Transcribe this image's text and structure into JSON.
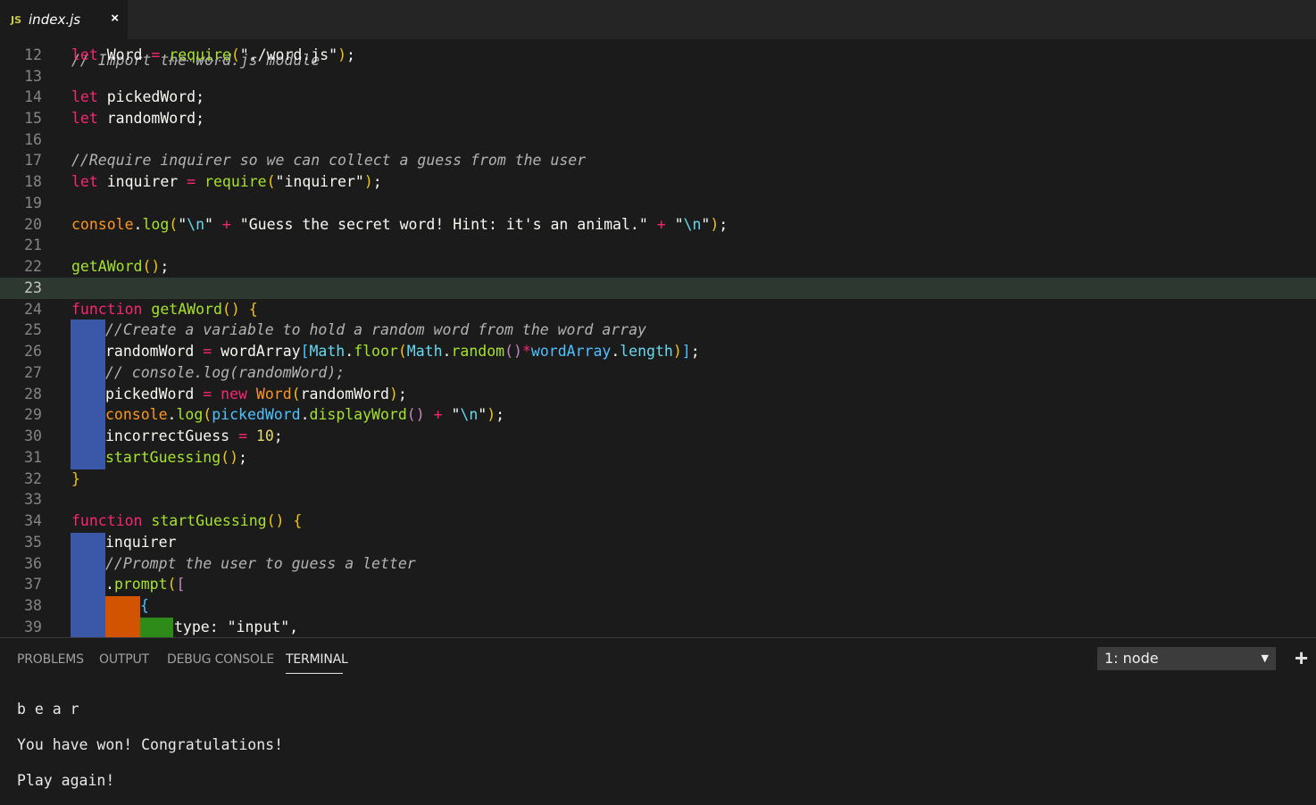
{
  "tab": {
    "icon_text": "JS",
    "title": "index.js",
    "close_glyph": "×"
  },
  "editor": {
    "partial_line": "// Import the word.js module",
    "lines": [
      {
        "n": "12"
      },
      {
        "n": "13"
      },
      {
        "n": "14"
      },
      {
        "n": "15"
      },
      {
        "n": "16"
      },
      {
        "n": "17"
      },
      {
        "n": "18"
      },
      {
        "n": "19"
      },
      {
        "n": "20"
      },
      {
        "n": "21"
      },
      {
        "n": "22"
      },
      {
        "n": "23"
      },
      {
        "n": "24"
      },
      {
        "n": "25"
      },
      {
        "n": "26"
      },
      {
        "n": "27"
      },
      {
        "n": "28"
      },
      {
        "n": "29"
      },
      {
        "n": "30"
      },
      {
        "n": "31"
      },
      {
        "n": "32"
      },
      {
        "n": "33"
      },
      {
        "n": "34"
      },
      {
        "n": "35"
      },
      {
        "n": "36"
      },
      {
        "n": "37"
      },
      {
        "n": "38"
      },
      {
        "n": "39"
      }
    ],
    "current_line": "23"
  },
  "panel": {
    "tabs": [
      "PROBLEMS",
      "OUTPUT",
      "DEBUG CONSOLE",
      "TERMINAL"
    ],
    "active_tab": "TERMINAL",
    "terminal_select": "1: node",
    "select_caret": "▼",
    "add_glyph": "+",
    "terminal_lines": [
      "b e a r",
      "You have won! Congratulations!",
      "Play again!"
    ]
  },
  "colors": {
    "current_line_bg": "#2d3830",
    "indent_blue": "#3a57a8",
    "indent_orange": "#d35400",
    "indent_green": "#2e8b1a"
  }
}
